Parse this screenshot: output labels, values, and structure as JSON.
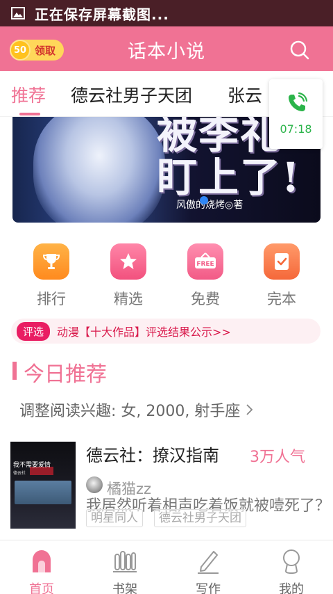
{
  "status_bar": {
    "text": "正在保存屏幕截图..."
  },
  "header": {
    "coin_amount": "50",
    "claim_label": "领取",
    "title": "话本小说"
  },
  "tabs": [
    {
      "label": "推荐"
    },
    {
      "label": "德云社男子天团"
    },
    {
      "label": "张云"
    }
  ],
  "call_widget": {
    "time": "07:18"
  },
  "banner": {
    "title_line1": "被李礼",
    "title_line2": "盯上了!",
    "author": "风傲的烧烤◎著"
  },
  "categories": [
    {
      "label": "排行",
      "icon": "trophy-icon"
    },
    {
      "label": "精选",
      "icon": "star-icon"
    },
    {
      "label": "免费",
      "icon": "free-icon"
    },
    {
      "label": "完本",
      "icon": "check-icon"
    }
  ],
  "notice": {
    "badge": "评选",
    "text": "动漫【十大作品】评选结果公示>>"
  },
  "section": {
    "title": "今日推荐",
    "preference": "调整阅读兴趣: 女, 2000, 射手座"
  },
  "book": {
    "title": "德云社：撩汉指南",
    "popularity": "3万人气",
    "author": "橘猫zz",
    "description": "我居然听着相声吃着饭就被噎死了？",
    "tags": [
      "明星同人",
      "德云社男子天团"
    ],
    "cover_line1": "我不需要爱情",
    "cover_line2": "德云社"
  },
  "bottom_nav": [
    {
      "label": "首页",
      "icon": "home-icon"
    },
    {
      "label": "书架",
      "icon": "bookshelf-icon"
    },
    {
      "label": "写作",
      "icon": "pen-icon"
    },
    {
      "label": "我的",
      "icon": "profile-icon"
    }
  ],
  "colors": {
    "accent": "#f07294",
    "status_bar": "#4a1f27",
    "coin": "#ffc21e",
    "call_green": "#2bb44a"
  }
}
